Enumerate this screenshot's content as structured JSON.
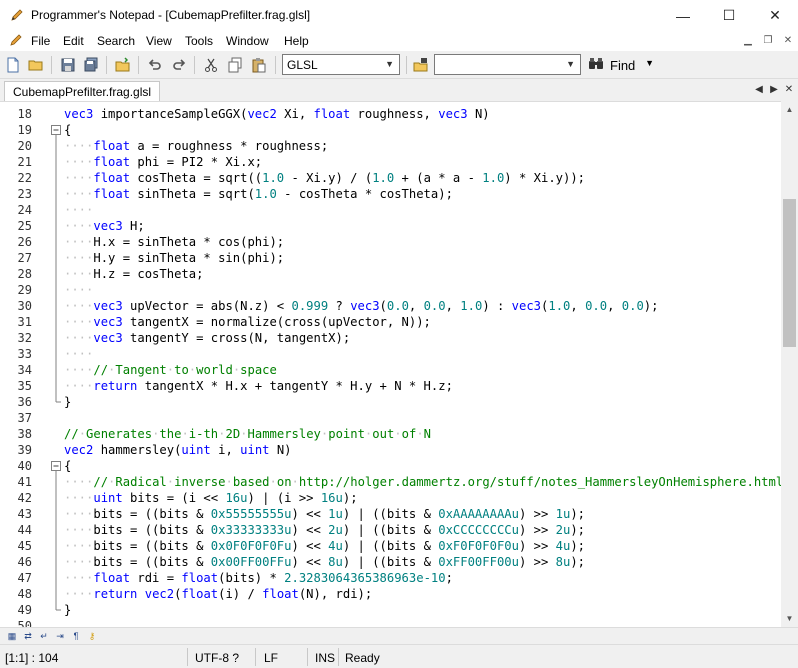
{
  "window": {
    "title": "Programmer's Notepad - [CubemapPrefilter.frag.glsl]",
    "minimize_glyph": "—",
    "maximize_glyph": "☐",
    "close_glyph": "✕"
  },
  "menu": {
    "items": [
      "File",
      "Edit",
      "Search",
      "View",
      "Tools",
      "Window",
      "Help"
    ]
  },
  "toolbar": {
    "language_selected": "GLSL",
    "find_value": "",
    "find_label": "Find"
  },
  "tabs": [
    {
      "label": "CubemapPrefilter.frag.glsl"
    }
  ],
  "editor": {
    "lines": [
      {
        "n": "18",
        "fold": "",
        "code": "<span class=\"kw\">vec3</span> importanceSampleGGX(<span class=\"kw\">vec2</span> Xi, <span class=\"kw\">float</span> roughness, <span class=\"kw\">vec3</span> N)"
      },
      {
        "n": "19",
        "fold": "box",
        "code": "{"
      },
      {
        "n": "20",
        "fold": "",
        "code": "<span class=\"ws\">····</span><span class=\"kw\">float</span> a = roughness * roughness;"
      },
      {
        "n": "21",
        "fold": "",
        "code": "<span class=\"ws\">····</span><span class=\"kw\">float</span> phi = PI2 * Xi.x;"
      },
      {
        "n": "22",
        "fold": "",
        "code": "<span class=\"ws\">····</span><span class=\"kw\">float</span> cosTheta = sqrt((<span class=\"num\">1.0</span> - Xi.y) / (<span class=\"num\">1.0</span> + (a * a - <span class=\"num\">1.0</span>) * Xi.y));"
      },
      {
        "n": "23",
        "fold": "",
        "code": "<span class=\"ws\">····</span><span class=\"kw\">float</span> sinTheta = sqrt(<span class=\"num\">1.0</span> - cosTheta * cosTheta);"
      },
      {
        "n": "24",
        "fold": "",
        "code": "<span class=\"ws\">····</span>"
      },
      {
        "n": "25",
        "fold": "",
        "code": "<span class=\"ws\">····</span><span class=\"kw\">vec3</span> H;"
      },
      {
        "n": "26",
        "fold": "",
        "code": "<span class=\"ws\">····</span>H.x = sinTheta * cos(phi);"
      },
      {
        "n": "27",
        "fold": "",
        "code": "<span class=\"ws\">····</span>H.y = sinTheta * sin(phi);"
      },
      {
        "n": "28",
        "fold": "",
        "code": "<span class=\"ws\">····</span>H.z = cosTheta;"
      },
      {
        "n": "29",
        "fold": "",
        "code": "<span class=\"ws\">····</span>"
      },
      {
        "n": "30",
        "fold": "",
        "code": "<span class=\"ws\">····</span><span class=\"kw\">vec3</span> upVector = abs(N.z) &lt; <span class=\"num\">0.999</span> ? <span class=\"kw\">vec3</span>(<span class=\"num\">0.0</span>, <span class=\"num\">0.0</span>, <span class=\"num\">1.0</span>) : <span class=\"kw\">vec3</span>(<span class=\"num\">1.0</span>, <span class=\"num\">0.0</span>, <span class=\"num\">0.0</span>);"
      },
      {
        "n": "31",
        "fold": "",
        "code": "<span class=\"ws\">····</span><span class=\"kw\">vec3</span> tangentX = normalize(cross(upVector, N));"
      },
      {
        "n": "32",
        "fold": "",
        "code": "<span class=\"ws\">····</span><span class=\"kw\">vec3</span> tangentY = cross(N, tangentX);"
      },
      {
        "n": "33",
        "fold": "",
        "code": "<span class=\"ws\">····</span>"
      },
      {
        "n": "34",
        "fold": "",
        "code": "<span class=\"ws\">····</span><span class=\"cmt\">//<span class=\"ws\">·</span>Tangent<span class=\"ws\">·</span>to<span class=\"ws\">·</span>world<span class=\"ws\">·</span>space</span>"
      },
      {
        "n": "35",
        "fold": "",
        "code": "<span class=\"ws\">····</span><span class=\"kw\">return</span> tangentX * H.x + tangentY * H.y + N * H.z;"
      },
      {
        "n": "36",
        "fold": "end",
        "code": "}"
      },
      {
        "n": "37",
        "fold": "",
        "code": ""
      },
      {
        "n": "38",
        "fold": "",
        "code": "<span class=\"cmt\">//<span class=\"ws\">·</span>Generates<span class=\"ws\">·</span>the<span class=\"ws\">·</span>i-th<span class=\"ws\">·</span>2D<span class=\"ws\">·</span>Hammersley<span class=\"ws\">·</span>point<span class=\"ws\">·</span>out<span class=\"ws\">·</span>of<span class=\"ws\">·</span>N</span>"
      },
      {
        "n": "39",
        "fold": "",
        "code": "<span class=\"kw\">vec2</span> hammersley(<span class=\"kw\">uint</span> i, <span class=\"kw\">uint</span> N)"
      },
      {
        "n": "40",
        "fold": "box",
        "code": "{"
      },
      {
        "n": "41",
        "fold": "",
        "code": "<span class=\"ws\">····</span><span class=\"cmt\">//<span class=\"ws\">·</span>Radical<span class=\"ws\">·</span>inverse<span class=\"ws\">·</span>based<span class=\"ws\">·</span>on<span class=\"ws\">·</span>http://holger.dammertz.org/stuff/notes_HammersleyOnHemisphere.html</span>"
      },
      {
        "n": "42",
        "fold": "",
        "code": "<span class=\"ws\">····</span><span class=\"kw\">uint</span> bits = (i &lt;&lt; <span class=\"num\">16u</span>) | (i &gt;&gt; <span class=\"num\">16u</span>);"
      },
      {
        "n": "43",
        "fold": "",
        "code": "<span class=\"ws\">····</span>bits = ((bits &amp; <span class=\"num\">0x55555555u</span>) &lt;&lt; <span class=\"num\">1u</span>) | ((bits &amp; <span class=\"num\">0xAAAAAAAAu</span>) &gt;&gt; <span class=\"num\">1u</span>);"
      },
      {
        "n": "44",
        "fold": "",
        "code": "<span class=\"ws\">····</span>bits = ((bits &amp; <span class=\"num\">0x33333333u</span>) &lt;&lt; <span class=\"num\">2u</span>) | ((bits &amp; <span class=\"num\">0xCCCCCCCCu</span>) &gt;&gt; <span class=\"num\">2u</span>);"
      },
      {
        "n": "45",
        "fold": "",
        "code": "<span class=\"ws\">····</span>bits = ((bits &amp; <span class=\"num\">0x0F0F0F0Fu</span>) &lt;&lt; <span class=\"num\">4u</span>) | ((bits &amp; <span class=\"num\">0xF0F0F0F0u</span>) &gt;&gt; <span class=\"num\">4u</span>);"
      },
      {
        "n": "46",
        "fold": "",
        "code": "<span class=\"ws\">····</span>bits = ((bits &amp; <span class=\"num\">0x00FF00FFu</span>) &lt;&lt; <span class=\"num\">8u</span>) | ((bits &amp; <span class=\"num\">0xFF00FF00u</span>) &gt;&gt; <span class=\"num\">8u</span>);"
      },
      {
        "n": "47",
        "fold": "",
        "code": "<span class=\"ws\">····</span><span class=\"kw\">float</span> rdi = <span class=\"kw\">float</span>(bits) * <span class=\"num\">2.3283064365386963e-10</span>;"
      },
      {
        "n": "48",
        "fold": "",
        "code": "<span class=\"ws\">····</span><span class=\"kw\">return</span> <span class=\"kw\">vec2</span>(<span class=\"kw\">float</span>(i) / <span class=\"kw\">float</span>(N), rdi);"
      },
      {
        "n": "49",
        "fold": "end",
        "code": "}"
      },
      {
        "n": "50",
        "fold": "",
        "code": ""
      }
    ]
  },
  "status": {
    "position": "[1:1] : 104",
    "encoding": "UTF-8 ?",
    "line_ending": "LF",
    "insert_mode": "INS",
    "state": "Ready"
  },
  "colors": {
    "keyword": "#0000ff",
    "number": "#008080",
    "comment": "#008000",
    "whitespace_marker": "#c0c0c0"
  }
}
